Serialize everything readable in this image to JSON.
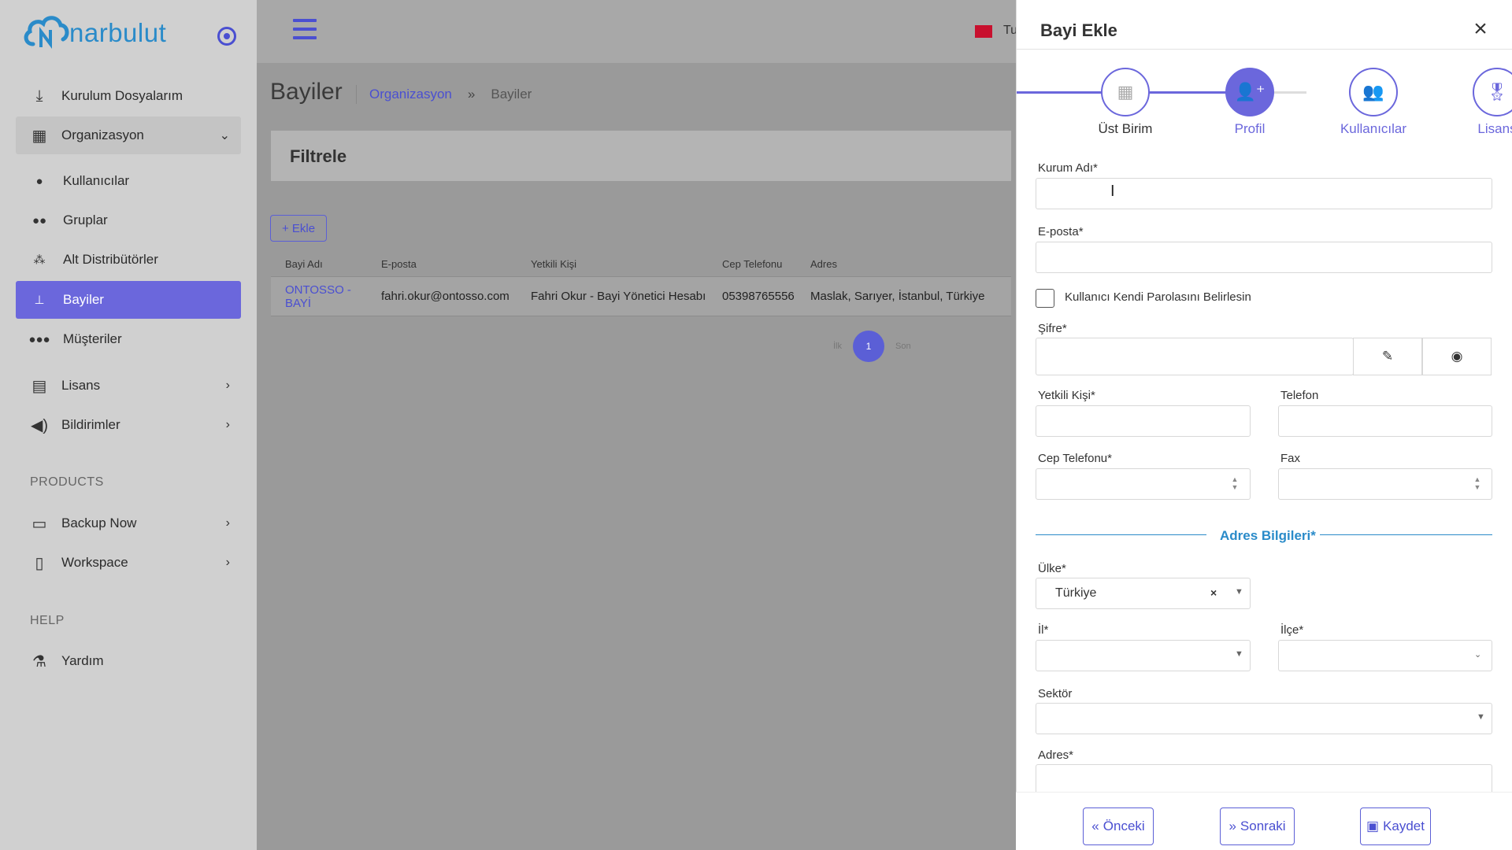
{
  "brand": {
    "name": "narbulut",
    "primary": "#6b67dc",
    "accent": "#2a8bc9"
  },
  "sidebar": {
    "items": [
      {
        "label": "Kurulum Dosyalarım",
        "icon": "download-icon"
      },
      {
        "label": "Organizasyon",
        "icon": "grid-icon"
      },
      {
        "label": "Kullanıcılar",
        "icon": "user-icon"
      },
      {
        "label": "Gruplar",
        "icon": "users-icon"
      },
      {
        "label": "Alt Distribütörler",
        "icon": "network-icon"
      },
      {
        "label": "Bayiler",
        "icon": "sitemap-icon"
      },
      {
        "label": "Müşteriler",
        "icon": "group-icon"
      },
      {
        "label": "Lisans",
        "icon": "id-card-icon"
      },
      {
        "label": "Bildirimler",
        "icon": "megaphone-icon"
      },
      {
        "label": "Backup Now",
        "icon": "server-icon"
      },
      {
        "label": "Workspace",
        "icon": "file-icon"
      },
      {
        "label": "Yardım",
        "icon": "flask-icon"
      }
    ],
    "sections": [
      "PRODUCTS",
      "HELP"
    ]
  },
  "topbar": {
    "lang": "Tu"
  },
  "main": {
    "title": "Bayiler",
    "breadcrumb": [
      "Organizasyon",
      "»",
      "Bayiler"
    ],
    "filter_title": "Filtrele",
    "add_button": "+ Ekle",
    "table": {
      "headers": [
        "Bayi Adı",
        "E-posta",
        "Yetkili Kişi",
        "Cep Telefonu",
        "Adres"
      ],
      "rows": [
        [
          "ONTOSSO - BAYİ",
          "fahri.okur@ontosso.com",
          "Fahri Okur - Bayi Yönetici Hesabı",
          "05398765556",
          "Maslak, Sarıyer, İstanbul, Türkiye"
        ]
      ]
    },
    "pager": {
      "first": "İlk",
      "page": "1",
      "last": "Son"
    }
  },
  "panel": {
    "title": "Bayi Ekle",
    "steps": [
      "Üst Birim",
      "Profil",
      "Kullanıcılar",
      "Lisans"
    ],
    "fields": {
      "kurum_adi": "Kurum Adı*",
      "eposta": "E-posta*",
      "checkbox": "Kullanıcı Kendi Parolasını Belirlesin",
      "sifre": "Şifre*",
      "yetkili": "Yetkili Kişi*",
      "telefon": "Telefon",
      "cep": "Cep Telefonu*",
      "fax": "Fax",
      "adres_bilgileri": "Adres Bilgileri*",
      "ulke": "Ülke*",
      "ulke_value": "Türkiye",
      "il": "İl*",
      "ilce": "İlçe*",
      "sektor": "Sektör",
      "adres": "Adres*"
    },
    "buttons": {
      "prev": "Önceki",
      "next": "Sonraki",
      "save": "Kaydet"
    }
  }
}
